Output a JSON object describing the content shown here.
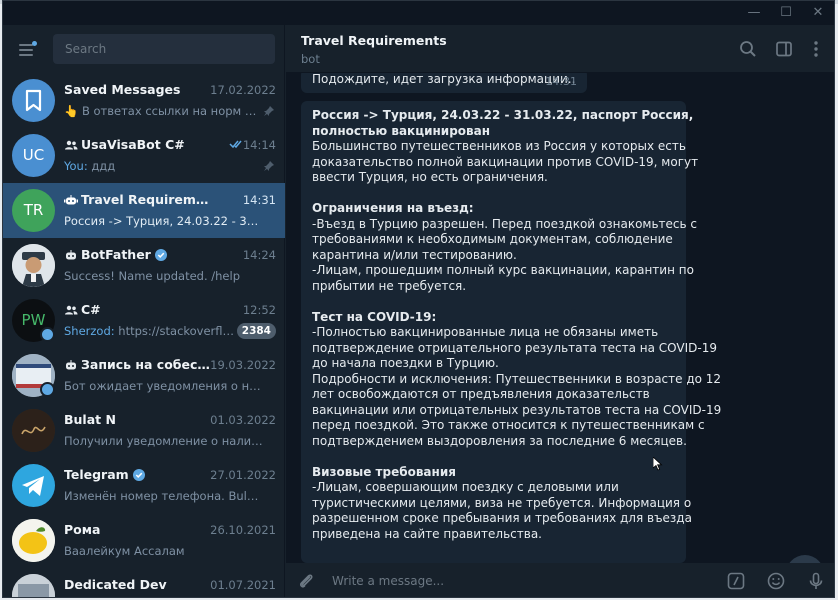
{
  "window": {
    "minimize": "—",
    "maximize": "☐",
    "close": "✕"
  },
  "sidebar": {
    "search_placeholder": "Search",
    "chats": [
      {
        "name": "Saved Messages",
        "time": "17.02.2022",
        "preview": "👆 В ответах ссылки на норм ВП...",
        "avatar_color": "#4a8fd1",
        "avatar_icon": "bookmark-icon",
        "pinned": true
      },
      {
        "name": "UsaVisaBot C#",
        "time": "14:14",
        "preview_prefix": "You: ",
        "preview": "ддд",
        "avatar_text": "UC",
        "avatar_color": "#4a8fd1",
        "type": "group",
        "read": true,
        "pinned": true
      },
      {
        "name": "Travel Requirements",
        "time": "14:31",
        "preview": "Россия -> Турция, 24.03.22 - 31.03.22,...",
        "avatar_text": "TR",
        "avatar_color": "#3fa35b",
        "type": "bot",
        "active": true
      },
      {
        "name": "BotFather",
        "time": "14:24",
        "preview": "Success! Name updated. /help",
        "avatar_color": "#e7ecf0",
        "avatar_icon": "botfather-avatar",
        "type": "bot",
        "verified": true
      },
      {
        "name": "C#",
        "time": "12:52",
        "preview_prefix": "Sherzod: ",
        "preview": "https://stackoverflo...",
        "avatar_text": "PW",
        "avatar_color": "#0c0f12",
        "type": "group",
        "badge": "2384"
      },
      {
        "name": "Запись на собеседов...",
        "time": "19.03.2022",
        "preview": "Бот ожидает уведомления о новых ...",
        "avatar_color": "#b9c6d3",
        "avatar_icon": "visa-avatar",
        "type": "bot"
      },
      {
        "name": "Bulat N",
        "time": "01.03.2022",
        "preview": "Получили уведомление о наличии ...",
        "avatar_color": "#3a2c22",
        "avatar_icon": "signature-avatar"
      },
      {
        "name": "Telegram",
        "time": "27.01.2022",
        "preview": "Изменён номер телефона. Bulat, Ва...",
        "avatar_color": "#2ea6df",
        "avatar_icon": "telegram-plane-icon",
        "verified": true
      },
      {
        "name": "Рома",
        "time": "26.10.2021",
        "preview": "Ваалейкум Ассалам",
        "avatar_color": "#f3c316",
        "avatar_icon": "lemon-avatar"
      },
      {
        "name": "Dedicated Dev",
        "time": "01.07.2021",
        "preview": "",
        "avatar_color": "#cfd6dc",
        "avatar_icon": "photo-avatar"
      }
    ]
  },
  "header": {
    "title": "Travel Requirements",
    "subtitle": "bot"
  },
  "messages": {
    "loading_text": "Подождите, идет загрузка информации..",
    "loading_time": "14:31",
    "main": [
      {
        "text": "Россия -> Турция, 24.03.22 - 31.03.22, паспорт Россия,",
        "bold": true
      },
      {
        "text": "полностью вакцинирован",
        "bold": true
      },
      {
        "text": "Большинство путешественников из Россия у которых есть"
      },
      {
        "text": "доказательство полной вакцинации против COVID-19, могут"
      },
      {
        "text": "ввести Турция, но есть ограничения."
      },
      {
        "text": ""
      },
      {
        "text": "Ограничения на въезд:",
        "bold": true
      },
      {
        "text": "-Въезд в Турцию разрешен. Перед поездкой ознакомьтесь с"
      },
      {
        "text": "требованиями к необходимым документам, соблюдение"
      },
      {
        "text": "карантина и/или тестированию."
      },
      {
        "text": "-Лицам, прошедшим полный курс вакцинации, карантин по"
      },
      {
        "text": "прибытии не требуется."
      },
      {
        "text": ""
      },
      {
        "text": "Тест на COVID-19:",
        "bold": true
      },
      {
        "text": "-Полностью вакцинированные лица не обязаны иметь"
      },
      {
        "text": "подтверждение отрицательного результата теста на COVID-19"
      },
      {
        "text": "до начала поездки в Турцию."
      },
      {
        "text": "Подробности и исключения: Путешественники в возрасте до 12"
      },
      {
        "text": "лет освобождаются от предъявления доказательств"
      },
      {
        "text": "вакцинации или отрицательных результатов теста на COVID-19"
      },
      {
        "text": "перед поездкой. Это также относится к путешественникам с"
      },
      {
        "text": "подтверждением выздоровления за последние 6 месяцев."
      },
      {
        "text": ""
      },
      {
        "text": "Визовые требования",
        "bold": true
      },
      {
        "text": "-Лицам, совершающим поездку с деловыми или"
      },
      {
        "text": "туристическими целями, виза не требуется. Информация о"
      },
      {
        "text": "разрешенном сроке пребывания и требованиях для въезда"
      },
      {
        "text": "приведена на сайте правительства."
      }
    ]
  },
  "composer": {
    "placeholder": "Write a message..."
  }
}
